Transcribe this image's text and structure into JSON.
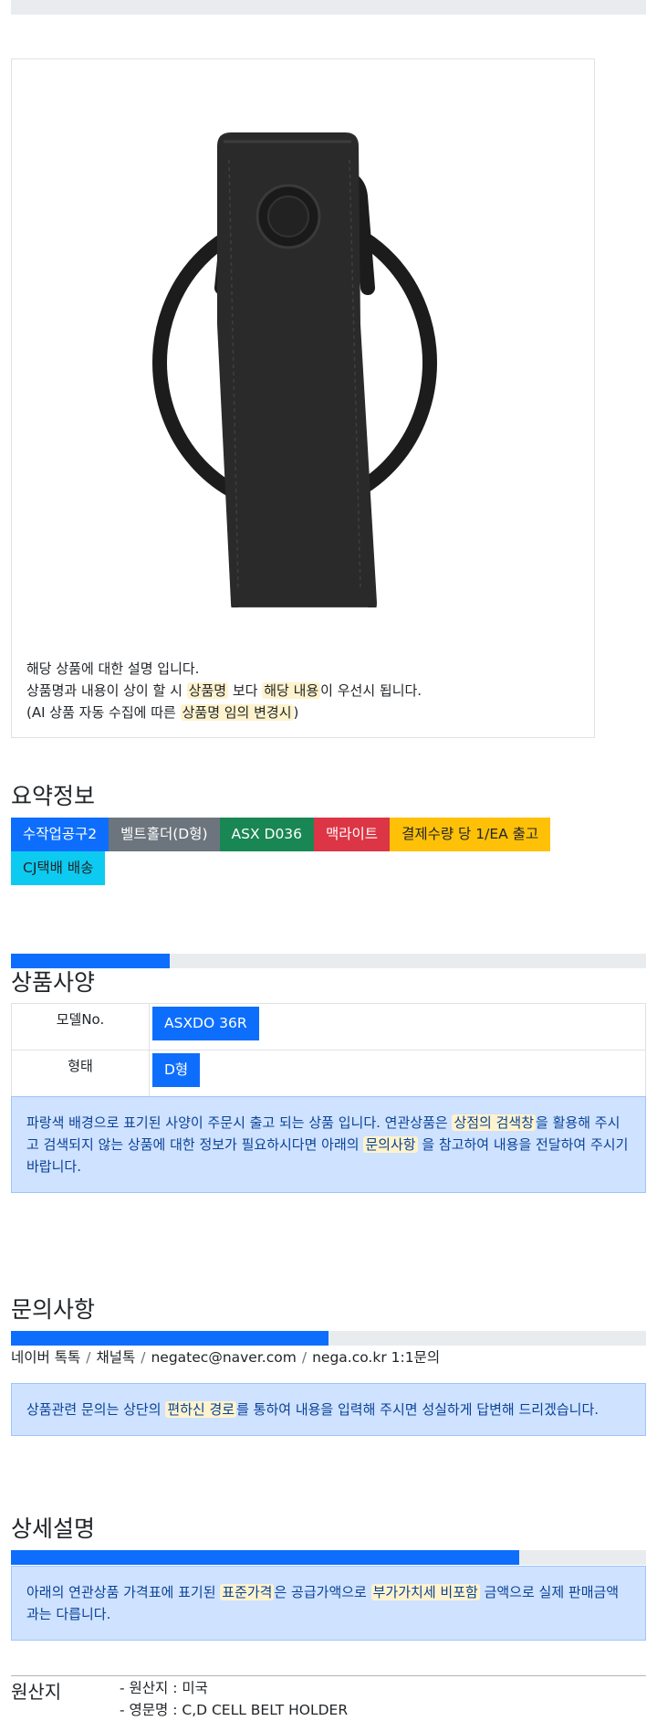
{
  "image_card": {
    "desc_lines": [
      {
        "parts": [
          {
            "t": "해당 상품에 대한 설명 입니다.",
            "hl": false
          }
        ]
      },
      {
        "parts": [
          {
            "t": "상품명과 내용이 상이 할 시 ",
            "hl": false
          },
          {
            "t": "상품명",
            "hl": true
          },
          {
            "t": " 보다 ",
            "hl": false
          },
          {
            "t": "해당 내용",
            "hl": true
          },
          {
            "t": "이 우선시 됩니다.",
            "hl": false
          }
        ]
      },
      {
        "parts": [
          {
            "t": "(AI 상품 자동 수집에 따른 ",
            "hl": false
          },
          {
            "t": "상품명 임의 변경시",
            "hl": true
          },
          {
            "t": ")",
            "hl": false
          }
        ]
      }
    ]
  },
  "summary": {
    "title": "요약정보",
    "badges": [
      {
        "label": "수작업공구2",
        "style": "primary"
      },
      {
        "label": "벨트홀더(D형)",
        "style": "secondary"
      },
      {
        "label": "ASX D036",
        "style": "success"
      },
      {
        "label": "맥라이트",
        "style": "danger"
      },
      {
        "label": "결제수량 당 1/EA 출고",
        "style": "warning"
      },
      {
        "label": "CJ택배 배송",
        "style": "info"
      }
    ]
  },
  "spec": {
    "title": "상품사양",
    "progress": 0.25,
    "rows": [
      {
        "label": "모델No.",
        "value": "ASXDO 36R"
      },
      {
        "label": "형태",
        "value": "D형"
      }
    ],
    "notice_parts": [
      {
        "t": "파랑색 배경으로 표기된 사양이 주문시 출고 되는 상품 입니다. 연관상품은 ",
        "hl": false
      },
      {
        "t": "상점의 검색창",
        "hl": true
      },
      {
        "t": "을 활용해 주시고 검색되지 않는 상품에 대한 정보가 필요하시다면 아래의 ",
        "hl": false
      },
      {
        "t": "문의사항",
        "hl": true
      },
      {
        "t": " 을 참고하여 내용을 전달하여 주시기 바랍니다.",
        "hl": false
      }
    ]
  },
  "inquiry": {
    "title": "문의사항",
    "progress": 0.5,
    "contacts": [
      "네이버 톡톡",
      "채널톡",
      "negatec@naver.com",
      "nega.co.kr 1:1문의"
    ],
    "notice_parts": [
      {
        "t": "상품관련 문의는 상단의 ",
        "hl": false
      },
      {
        "t": "편하신 경로",
        "hl": true
      },
      {
        "t": "를 통하여 내용을 입력해 주시면 성실하게 답변해 드리겠습니다.",
        "hl": false
      }
    ]
  },
  "detail": {
    "title": "상세설명",
    "progress": 0.8,
    "notice_parts": [
      {
        "t": "아래의 연관상품 가격표에 표기된 ",
        "hl": false
      },
      {
        "t": "표준가격",
        "hl": true
      },
      {
        "t": "은 공급가액으로 ",
        "hl": false
      },
      {
        "t": "부가가치세 비포함",
        "hl": true
      },
      {
        "t": " 금액으로 실제 판매금액과는 다릅니다.",
        "hl": false
      }
    ]
  },
  "origin": {
    "label": "원산지",
    "values": [
      "- 원산지 : 미국",
      "- 영문명 : C,D CELL BELT HOLDER"
    ]
  }
}
